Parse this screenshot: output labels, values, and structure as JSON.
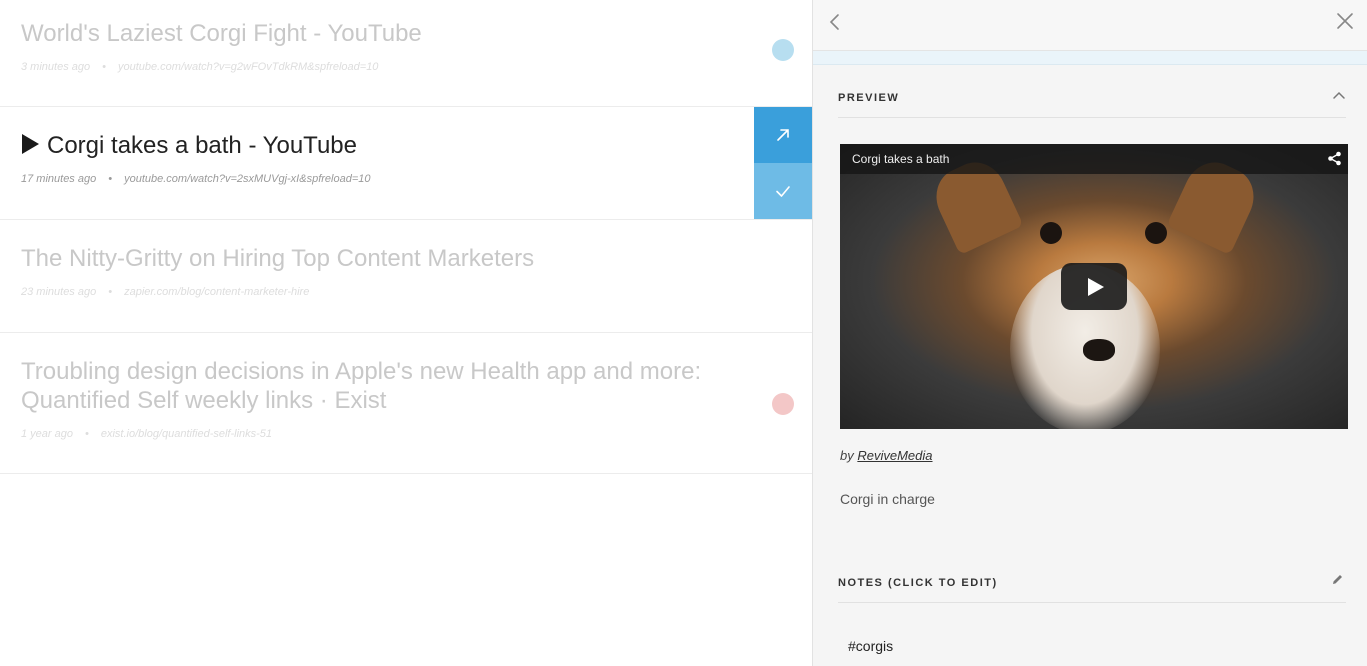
{
  "items": [
    {
      "title": "World's Laziest Corgi Fight - YouTube",
      "time": "3 minutes ago",
      "url": "youtube.com/watch?v=g2wFOvTdkRM&spfreload=10",
      "dot_color": "#b7def0"
    },
    {
      "title": "Corgi takes a bath - YouTube",
      "time": "17 minutes ago",
      "url": "youtube.com/watch?v=2sxMUVgj-xI&spfreload=10",
      "selected": true
    },
    {
      "title": "The Nitty-Gritty on Hiring Top Content Marketers",
      "time": "23 minutes ago",
      "url": "zapier.com/blog/content-marketer-hire"
    },
    {
      "title": "Troubling design decisions in Apple's new Health app and more: Quantified Self weekly links · Exist",
      "time": "1 year ago",
      "url": "exist.io/blog/quantified-self-links-51",
      "dot_color": "#f3c7c7"
    }
  ],
  "item_separator": "•",
  "actions": {
    "open_icon": "arrow-up-right-icon",
    "done_icon": "checkmark-icon",
    "open_color": "#3a9fdb",
    "done_color": "#6ebbe6"
  },
  "panel": {
    "back_icon": "chevron-left-icon",
    "close_icon": "close-icon",
    "preview": {
      "heading": "PREVIEW",
      "collapse_icon": "chevron-up-icon",
      "video_title": "Corgi takes a bath",
      "share_icon": "share-icon",
      "play_icon": "play-icon",
      "by_prefix": "by",
      "author": "ReviveMedia",
      "description": "Corgi in charge"
    },
    "notes": {
      "heading": "NOTES (CLICK TO EDIT)",
      "edit_icon": "pencil-icon",
      "text": "#corgis"
    }
  }
}
